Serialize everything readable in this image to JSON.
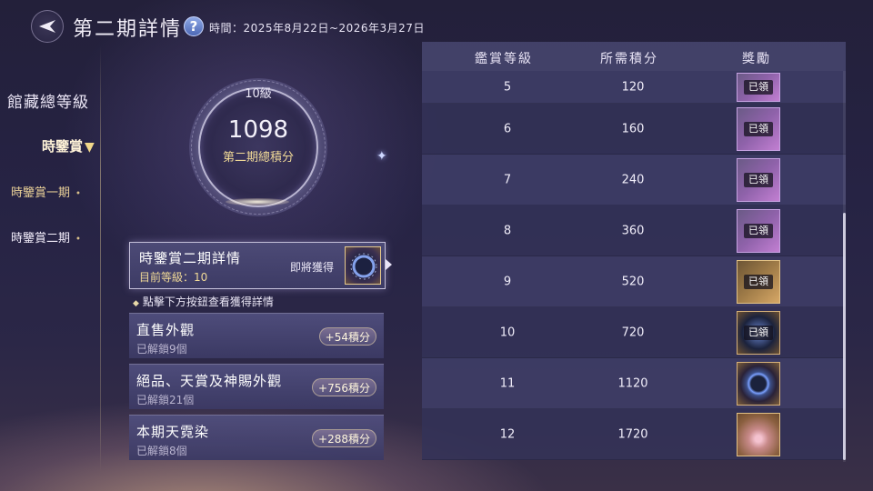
{
  "header": {
    "title": "第二期詳情",
    "help_icon": "question-icon",
    "period": "時間：2025年8月22日~2026年3月27日"
  },
  "sidebar": {
    "heading": "館藏總等級",
    "main_item": "時鑒賞",
    "sub_items": [
      {
        "label": "時鑒賞一期",
        "marker": "•"
      },
      {
        "label": "時鑒賞二期",
        "marker": "•"
      }
    ]
  },
  "score": {
    "level": "10級",
    "total": "1098",
    "caption": "第二期總積分"
  },
  "detail_card": {
    "title": "時鑒賞二期詳情",
    "level_text": "目前等級：10",
    "upcoming_label": "即將獲得"
  },
  "hint": "點擊下方按鈕查看獲得詳情",
  "categories": [
    {
      "name": "直售外觀",
      "unlocked": "已解鎖9個",
      "points": "+54積分"
    },
    {
      "name": "絕品、天賞及神賜外觀",
      "unlocked": "已解鎖21個",
      "points": "+756積分"
    },
    {
      "name": "本期天霓染",
      "unlocked": "已解鎖8個",
      "points": "+288積分"
    }
  ],
  "table": {
    "headers": {
      "level": "鑑賞等級",
      "points": "所需積分",
      "reward": "獎勵"
    },
    "claimed_label": "已領",
    "rows": [
      {
        "level": "5",
        "points": "120",
        "reward_style": "purple",
        "claimed": true
      },
      {
        "level": "6",
        "points": "160",
        "reward_style": "purple",
        "claimed": true
      },
      {
        "level": "7",
        "points": "240",
        "reward_style": "purple",
        "claimed": true
      },
      {
        "level": "8",
        "points": "360",
        "reward_style": "purple",
        "claimed": true
      },
      {
        "level": "9",
        "points": "520",
        "reward_style": "gold",
        "claimed": true
      },
      {
        "level": "10",
        "points": "720",
        "reward_style": "dark",
        "claimed": true
      },
      {
        "level": "11",
        "points": "1120",
        "reward_style": "ring",
        "claimed": false
      },
      {
        "level": "12",
        "points": "1720",
        "reward_style": "pink",
        "claimed": false
      }
    ]
  },
  "colors": {
    "accent_gold": "#f0d997",
    "panel": "#403e68",
    "background": "#262344"
  }
}
